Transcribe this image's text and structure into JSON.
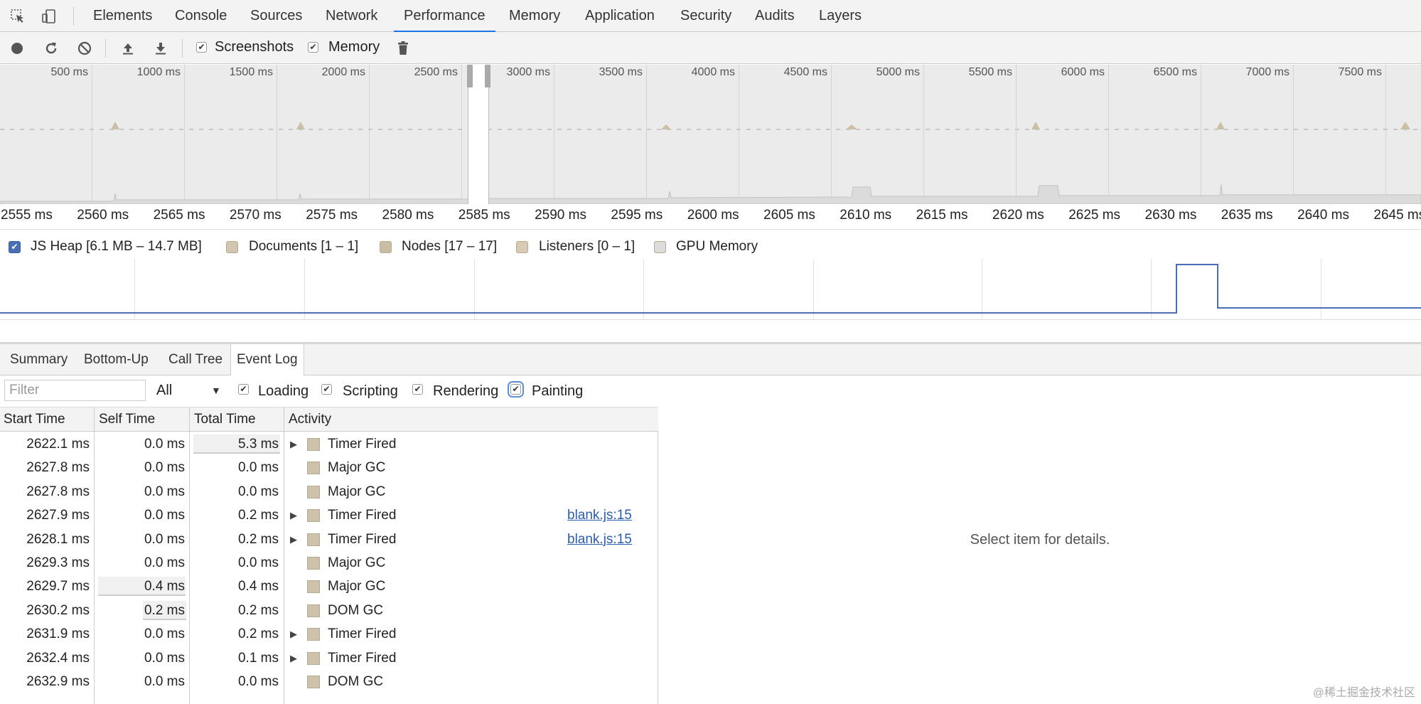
{
  "devtools_tabs": [
    "Elements",
    "Console",
    "Sources",
    "Network",
    "Performance",
    "Memory",
    "Application",
    "Security",
    "Audits",
    "Layers"
  ],
  "active_tab": "Performance",
  "toolbar": {
    "screenshots_label": "Screenshots",
    "screenshots_checked": true,
    "memory_label": "Memory",
    "memory_checked": true
  },
  "overview_ticks": [
    "500 ms",
    "1000 ms",
    "1500 ms",
    "2000 ms",
    "2500 ms",
    "3000 ms",
    "3500 ms",
    "4000 ms",
    "4500 ms",
    "5000 ms",
    "5500 ms",
    "6000 ms",
    "6500 ms",
    "7000 ms",
    "7500 ms"
  ],
  "ruler_ticks": [
    "2555 ms",
    "2560 ms",
    "2565 ms",
    "2570 ms",
    "2575 ms",
    "2580 ms",
    "2585 ms",
    "2590 ms",
    "2595 ms",
    "2600 ms",
    "2605 ms",
    "2610 ms",
    "2615 ms",
    "2620 ms",
    "2625 ms",
    "2630 ms",
    "2635 ms",
    "2640 ms",
    "2645 ms"
  ],
  "counters": [
    {
      "label": "JS Heap [6.1 MB – 14.7 MB]",
      "color": "#4a6fb5",
      "checked": true
    },
    {
      "label": "Documents [1 – 1]",
      "color": "#d3c6b0",
      "checked": false
    },
    {
      "label": "Nodes [17 – 17]",
      "color": "#c7bea3",
      "checked": false
    },
    {
      "label": "Listeners [0 – 1]",
      "color": "#d9cbb3",
      "checked": false
    },
    {
      "label": "GPU Memory",
      "color": "#dcdcdc",
      "checked": false
    }
  ],
  "bottom_tabs": [
    "Summary",
    "Bottom-Up",
    "Call Tree",
    "Event Log"
  ],
  "active_bottom_tab": "Event Log",
  "filter": {
    "placeholder": "Filter",
    "select_value": "All",
    "categories": [
      {
        "label": "Loading",
        "checked": true
      },
      {
        "label": "Scripting",
        "checked": true
      },
      {
        "label": "Rendering",
        "checked": true
      },
      {
        "label": "Painting",
        "checked": true
      }
    ]
  },
  "columns": [
    "Start Time",
    "Self Time",
    "Total Time",
    "Activity"
  ],
  "rows": [
    {
      "start": "2622.1 ms",
      "self": "0.0 ms",
      "total": "5.3 ms",
      "activity": "Timer Fired",
      "expandable": true,
      "link": ""
    },
    {
      "start": "2627.8 ms",
      "self": "0.0 ms",
      "total": "0.0 ms",
      "activity": "Major GC",
      "expandable": false,
      "link": ""
    },
    {
      "start": "2627.8 ms",
      "self": "0.0 ms",
      "total": "0.0 ms",
      "activity": "Major GC",
      "expandable": false,
      "link": ""
    },
    {
      "start": "2627.9 ms",
      "self": "0.0 ms",
      "total": "0.2 ms",
      "activity": "Timer Fired",
      "expandable": true,
      "link": "blank.js:15"
    },
    {
      "start": "2628.1 ms",
      "self": "0.0 ms",
      "total": "0.2 ms",
      "activity": "Timer Fired",
      "expandable": true,
      "link": "blank.js:15"
    },
    {
      "start": "2629.3 ms",
      "self": "0.0 ms",
      "total": "0.0 ms",
      "activity": "Major GC",
      "expandable": false,
      "link": ""
    },
    {
      "start": "2629.7 ms",
      "self": "0.4 ms",
      "total": "0.4 ms",
      "activity": "Major GC",
      "expandable": false,
      "link": ""
    },
    {
      "start": "2630.2 ms",
      "self": "0.2 ms",
      "total": "0.2 ms",
      "activity": "DOM GC",
      "expandable": false,
      "link": ""
    },
    {
      "start": "2631.9 ms",
      "self": "0.0 ms",
      "total": "0.2 ms",
      "activity": "Timer Fired",
      "expandable": true,
      "link": ""
    },
    {
      "start": "2632.4 ms",
      "self": "0.0 ms",
      "total": "0.1 ms",
      "activity": "Timer Fired",
      "expandable": true,
      "link": ""
    },
    {
      "start": "2632.9 ms",
      "self": "0.0 ms",
      "total": "0.0 ms",
      "activity": "DOM GC",
      "expandable": false,
      "link": ""
    }
  ],
  "details_text": "Select item for details.",
  "watermark": "@稀土掘金技术社区"
}
